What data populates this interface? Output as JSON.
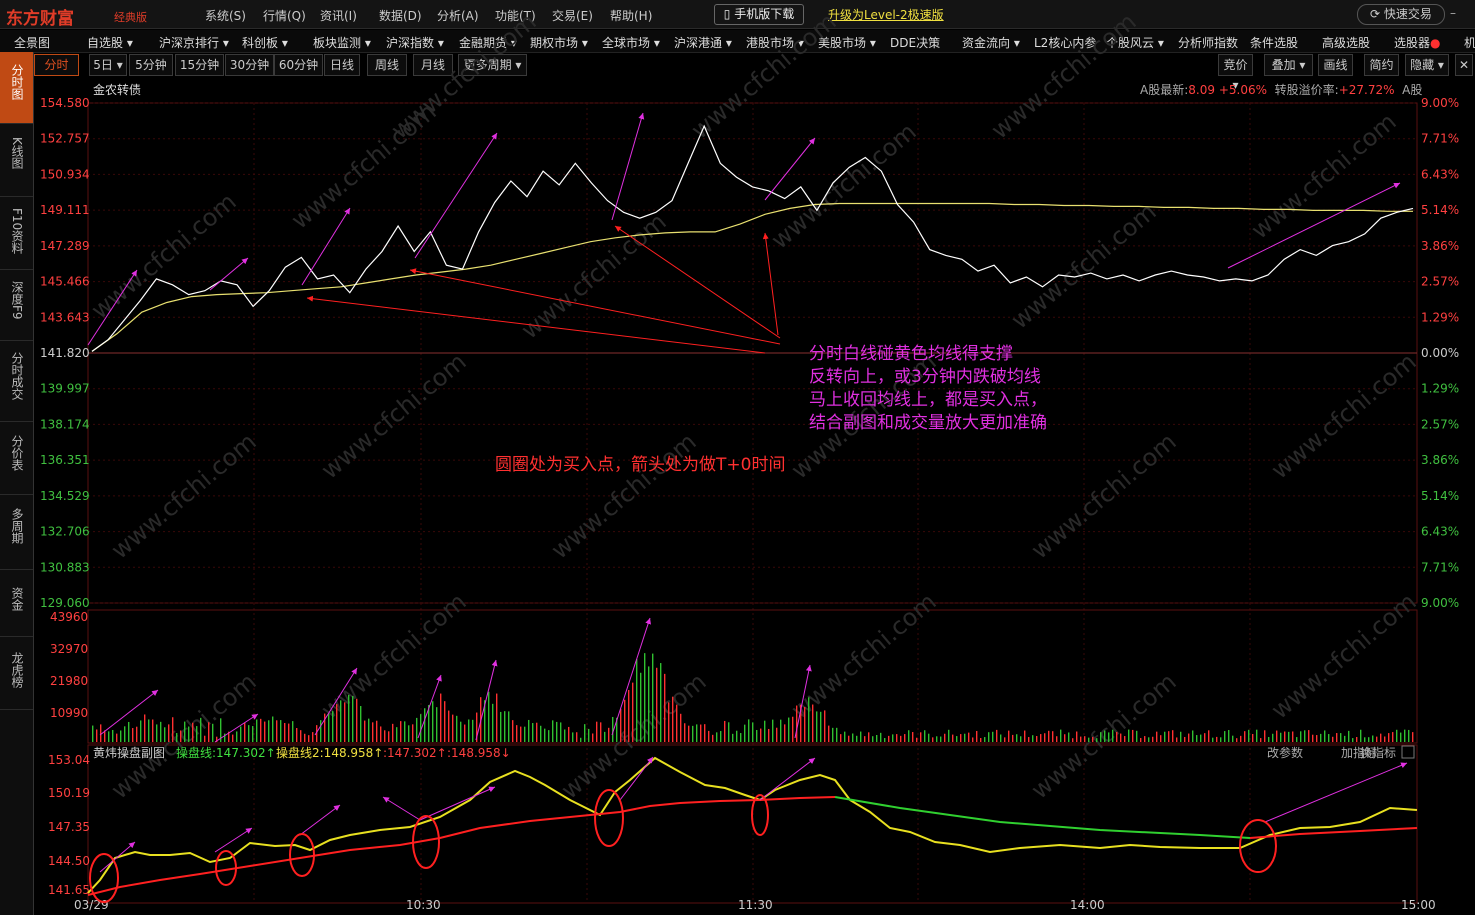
{
  "titlebar": {
    "logo": "东方财富",
    "edition": "经典版",
    "menu": [
      "系统(S)",
      "行情(Q)",
      "资讯(I)",
      "数据(D)",
      "分析(A)",
      "功能(T)",
      "交易(E)",
      "帮助(H)"
    ],
    "mobile_download": "手机版下载",
    "upgrade": "升级为Level-2极速版",
    "quick_trade": "快速交易"
  },
  "navbar": {
    "items": [
      "全景图",
      "自选股 ▾",
      "沪深京排行 ▾",
      "科创板 ▾",
      "板块监测 ▾",
      "沪深指数 ▾",
      "金融期货 ▾",
      "期权市场 ▾",
      "全球市场 ▾",
      "沪深港通 ▾",
      "港股市场 ▾",
      "美股市场 ▾",
      "DDE决策",
      "资金流向 ▾",
      "L2核心内参",
      "个股风云 ▾",
      "分析师指数",
      "条件选股",
      "高级选股",
      "选股器",
      "机"
    ]
  },
  "sidebar": {
    "tabs": [
      "分时图",
      "K线图",
      "F10资料",
      "深度F9",
      "分时成交",
      "分价表",
      "多周期",
      "资金",
      "龙虎榜"
    ]
  },
  "periods": [
    "分时",
    "5日 ▾",
    "5分钟",
    "15分钟",
    "30分钟",
    "60分钟",
    "日线",
    "周线",
    "月线",
    "更多周期 ▾"
  ],
  "toolbar": [
    "竞价 ▾",
    "叠加 ▾",
    "画线",
    "简约",
    "隐藏 ▾"
  ],
  "stock": {
    "name": "金农转债",
    "a_share_label": "A股最新:",
    "a_share_price": "8.09",
    "a_share_change": "+5.06%",
    "premium_label": "转股溢价率:",
    "premium_value": "+27.72%",
    "a_tag": "A股"
  },
  "price_axis": {
    "left": [
      "154.580",
      "152.757",
      "150.934",
      "149.111",
      "147.289",
      "145.466",
      "143.643",
      "141.820",
      "139.997",
      "138.174",
      "136.351",
      "134.529",
      "132.706",
      "130.883",
      "129.060"
    ],
    "right": [
      "9.00%",
      "7.71%",
      "6.43%",
      "5.14%",
      "3.86%",
      "2.57%",
      "1.29%",
      "0.00%",
      "1.29%",
      "2.57%",
      "3.86%",
      "5.14%",
      "6.43%",
      "7.71%",
      "9.00%"
    ]
  },
  "volume_axis": [
    "43960",
    "32970",
    "21980",
    "10990"
  ],
  "indicator": {
    "name": "黄炜操盘副图",
    "line1_label": "操盘线:",
    "line1_value": "147.302↑",
    "line2_label": "操盘线2:",
    "line2_value": "148.958↑",
    "v1": ":147.302↑",
    "v2": ":148.958↓",
    "btns": [
      "改参数",
      "加指标",
      "换指标"
    ],
    "axis": [
      "153.04",
      "150.19",
      "147.35",
      "144.50",
      "141.65"
    ]
  },
  "time_axis": [
    "03/29",
    "10:30",
    "11:30",
    "14:00",
    "15:00"
  ],
  "annotations": {
    "purple": [
      "分时白线碰黄色均线得支撑",
      "反转向上，或3分钟内跌破均线",
      "马上收回均线上，都是买入点，",
      "结合副图和成交量放大更加准确"
    ],
    "red": "圆圈处为买入点，箭头处为做T+0时间"
  },
  "watermark": "www.cfchi.com",
  "colors": {
    "price_line": "#ffffff",
    "avg_line": "#e8e070",
    "up": "#ff4040",
    "down": "#40d040",
    "annot_purple": "#e030e0",
    "annot_red": "#ff3030",
    "accent": "#c04a14"
  },
  "chart_data": {
    "type": "line",
    "series": [
      {
        "values": [
          141.9,
          142.5,
          143.5,
          144.5,
          145.6,
          145.3,
          144.8,
          145.0,
          145.5,
          145.3,
          144.2,
          145.0,
          146.2,
          146.7,
          145.6,
          145.8,
          144.9,
          146.1,
          147.0,
          148.3,
          147.0,
          148.0,
          146.3,
          146.1,
          148.0,
          149.5,
          150.6,
          149.8,
          151.1,
          150.4,
          151.5,
          150.5,
          149.6,
          149.0,
          148.7,
          149.0,
          149.6,
          151.5,
          153.4,
          151.5,
          150.8,
          150.3,
          150.1,
          149.7,
          150.3,
          149.1,
          150.5,
          151.3,
          151.8,
          151.1,
          149.4,
          148.5,
          147.1,
          146.8,
          146.6,
          146.0,
          146.3,
          145.4,
          145.7,
          145.2,
          145.8,
          145.7,
          145.9,
          145.6,
          145.8,
          145.5,
          145.8,
          146.0,
          145.8,
          145.7,
          145.5,
          145.6,
          145.5,
          145.8,
          146.6,
          147.1,
          146.8,
          147.3,
          147.5,
          147.9,
          148.7,
          149.0,
          149.2
        ]
      },
      {
        "values": [
          141.9,
          142.8,
          143.9,
          144.4,
          144.7,
          144.8,
          144.85,
          144.9,
          145.0,
          145.1,
          145.2,
          145.4,
          145.6,
          145.8,
          145.95,
          146.1,
          146.3,
          146.6,
          146.9,
          147.2,
          147.5,
          147.7,
          147.85,
          147.95,
          148.0,
          148.0,
          148.4,
          148.9,
          149.2,
          149.4,
          149.45,
          149.45,
          149.45,
          149.45,
          149.45,
          149.45,
          149.45,
          149.4,
          149.4,
          149.35,
          149.35,
          149.3,
          149.3,
          149.25,
          149.25,
          149.2,
          149.2,
          149.15,
          149.15,
          149.1,
          149.1,
          149.1,
          149.05,
          149.05
        ]
      }
    ],
    "ylim": [
      129.06,
      154.58
    ]
  }
}
